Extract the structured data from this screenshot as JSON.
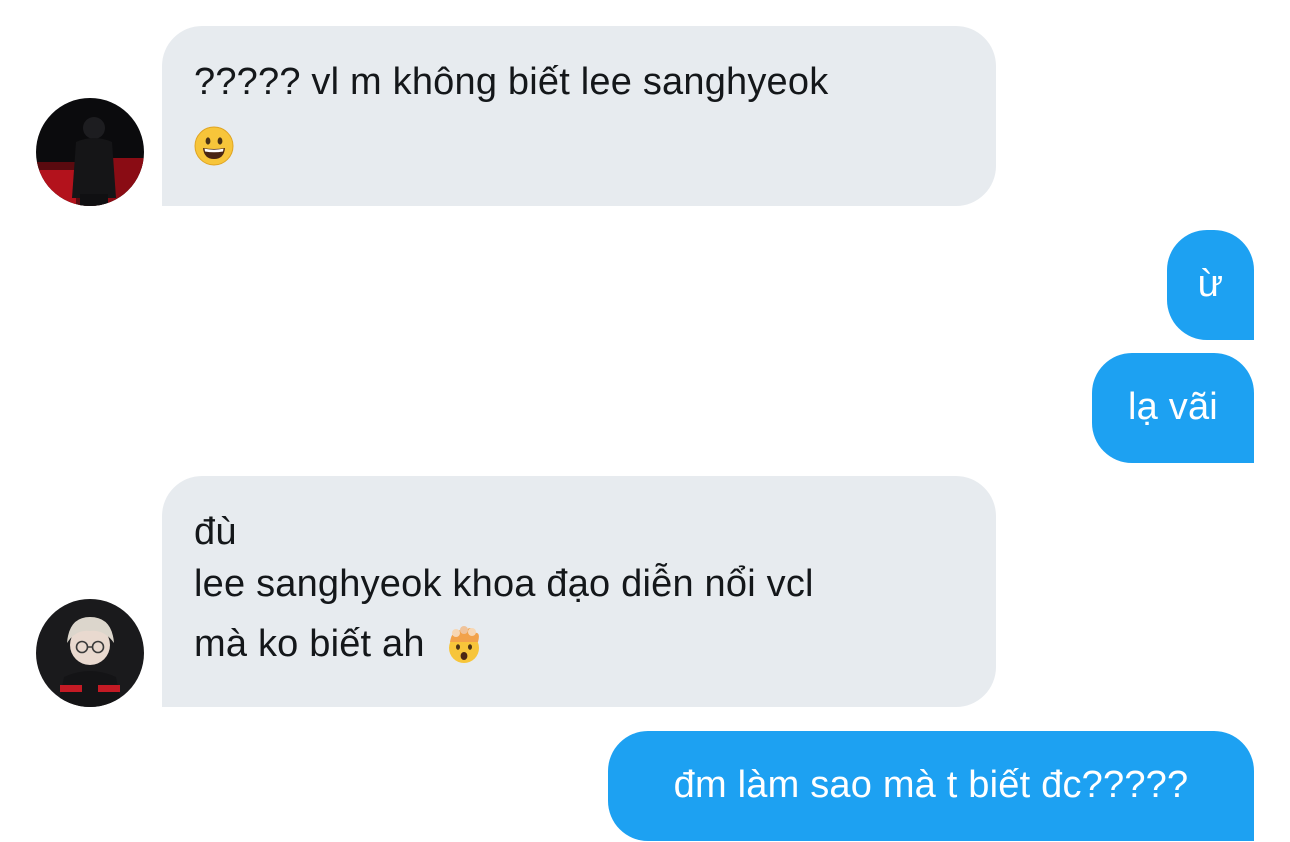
{
  "messages": [
    {
      "from": "other",
      "avatar": "avatar-person-black-hoodie",
      "lines": [
        "????? vl m không biết lee sanghyeok"
      ],
      "emoji": "grinning-face-emoji"
    },
    {
      "from": "me",
      "lines": [
        "ừ"
      ]
    },
    {
      "from": "me",
      "lines": [
        "lạ vãi"
      ]
    },
    {
      "from": "other",
      "avatar": "avatar-person-glasses-blonde",
      "lines": [
        "đù",
        "lee sanghyeok khoa đạo diễn nổi vcl",
        "mà ko biết ah"
      ],
      "emoji": "exploding-head-emoji"
    },
    {
      "from": "me",
      "lines": [
        "đm làm sao mà t biết đc?????"
      ]
    }
  ],
  "colors": {
    "incoming_bubble": "#e7ebef",
    "incoming_text": "#14171a",
    "outgoing_bubble": "#1da1f2",
    "outgoing_text": "#ffffff"
  }
}
